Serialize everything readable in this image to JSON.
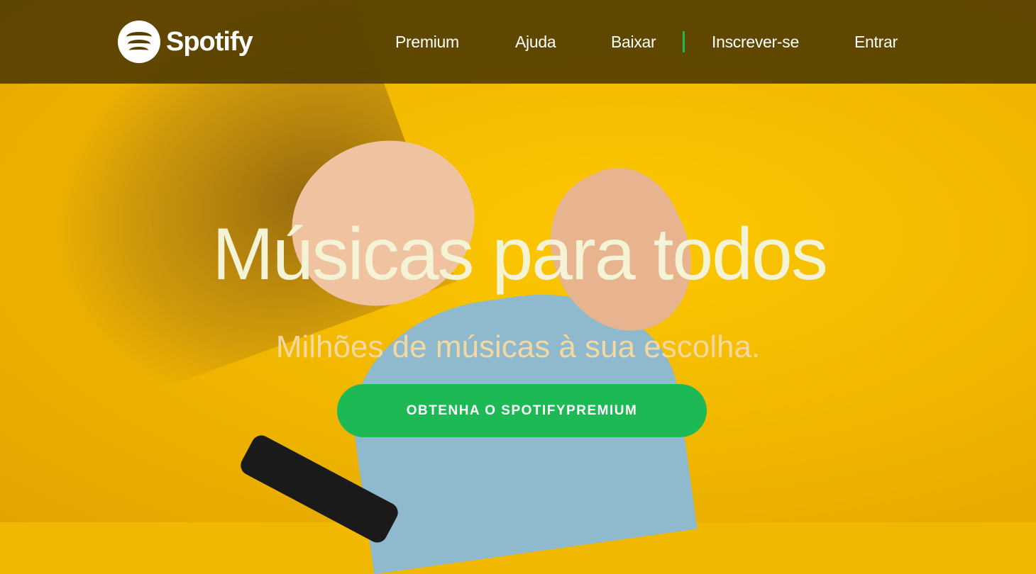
{
  "brand": {
    "name": "Spotify",
    "accent": "#1db954"
  },
  "nav": {
    "items": [
      "Premium",
      "Ajuda",
      "Baixar",
      "Inscrever-se",
      "Entrar"
    ]
  },
  "hero": {
    "title": "Músicas para todos",
    "subtitle": "Milhões de músicas à sua escolha.",
    "cta": "OBTENHA O SPOTIFYPREMIUM"
  }
}
